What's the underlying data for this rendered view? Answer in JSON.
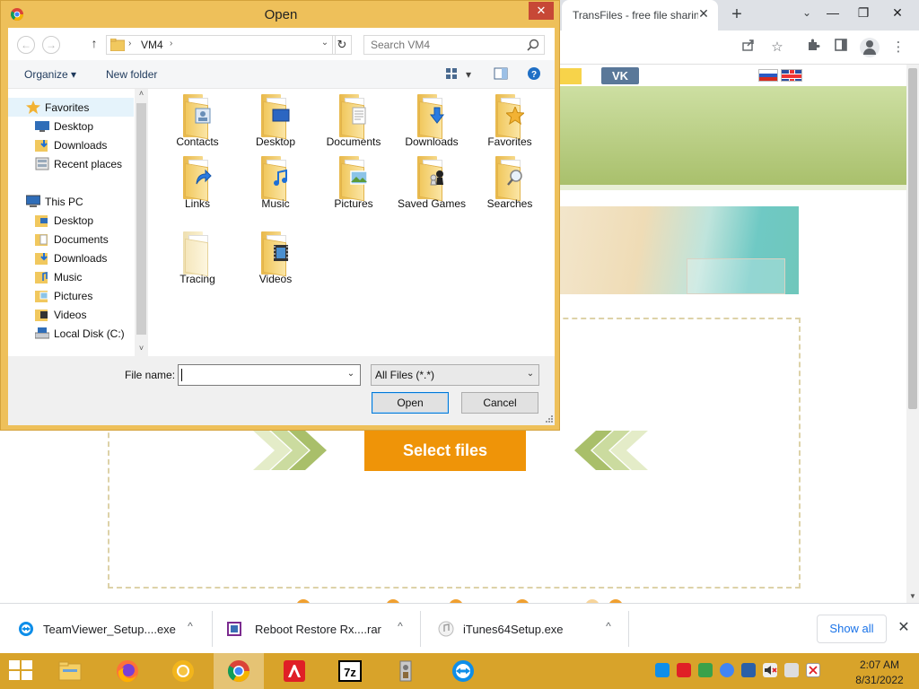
{
  "browser": {
    "tab_title": "TransFiles - free file sharing",
    "tab_close": "✕",
    "new_tab": "+",
    "tab_search": "⌄",
    "minimize": "—",
    "restore": "❐",
    "close": "✕",
    "toolbar_icons": [
      "share-icon",
      "bookmark-star-icon",
      "extensions-icon",
      "side-panel-icon",
      "profile-icon",
      "kebab-menu-icon"
    ]
  },
  "page": {
    "nav_vk": "VK",
    "select_button": "Select files",
    "accent_color": "#ef9408",
    "header_color": "#a9c06c"
  },
  "dialog": {
    "title": "Open",
    "close": "✕",
    "back": "←",
    "forward": "→",
    "up": "↑",
    "address": {
      "chevron": "›",
      "path": "VM4",
      "chevron2": "›",
      "dropdown": "⌄"
    },
    "refresh": "↻",
    "search_placeholder": "Search VM4",
    "organize": "Organize ▾",
    "new_folder": "New folder",
    "view_dropdown": "▾",
    "nav": {
      "favorites_header": "Favorites",
      "favorites": [
        "Desktop",
        "Downloads",
        "Recent places"
      ],
      "this_pc_header": "This PC",
      "this_pc": [
        "Desktop",
        "Documents",
        "Downloads",
        "Music",
        "Pictures",
        "Videos",
        "Local Disk (C:)"
      ],
      "scroll_up": "˄",
      "scroll_down": "˅"
    },
    "files": [
      "Contacts",
      "Desktop",
      "Documents",
      "Downloads",
      "Favorites",
      "Links",
      "Music",
      "Pictures",
      "Saved Games",
      "Searches",
      "Tracing",
      "Videos"
    ],
    "file_name_label": "File name:",
    "file_name_value": "",
    "file_name_dropdown": "⌄",
    "file_type": "All Files (*.*)",
    "file_type_dropdown": "⌄",
    "open_button": "Open",
    "cancel_button": "Cancel"
  },
  "downloads": {
    "items": [
      {
        "name": "TeamViewer_Setup....exe",
        "caret": "^"
      },
      {
        "name": "Reboot Restore Rx....rar",
        "caret": "^"
      },
      {
        "name": "iTunes64Setup.exe",
        "caret": "^"
      }
    ],
    "show_all": "Show all",
    "close": "✕"
  },
  "taskbar": {
    "time": "2:07 AM",
    "date": "8/31/2022",
    "apps": [
      "file-explorer-icon",
      "firefox-icon",
      "chrome-canary-icon",
      "chrome-icon",
      "avira-icon",
      "7zip-icon",
      "installer-icon",
      "teamviewer-icon"
    ],
    "sevenzip_label": "7z",
    "tray_icons": [
      "teamviewer-tray-icon",
      "avira-tray-icon",
      "network-status-icon",
      "chrome-tray-icon",
      "bluetooth-icon",
      "volume-muted-icon",
      "network-icon",
      "action-center-icon"
    ]
  }
}
